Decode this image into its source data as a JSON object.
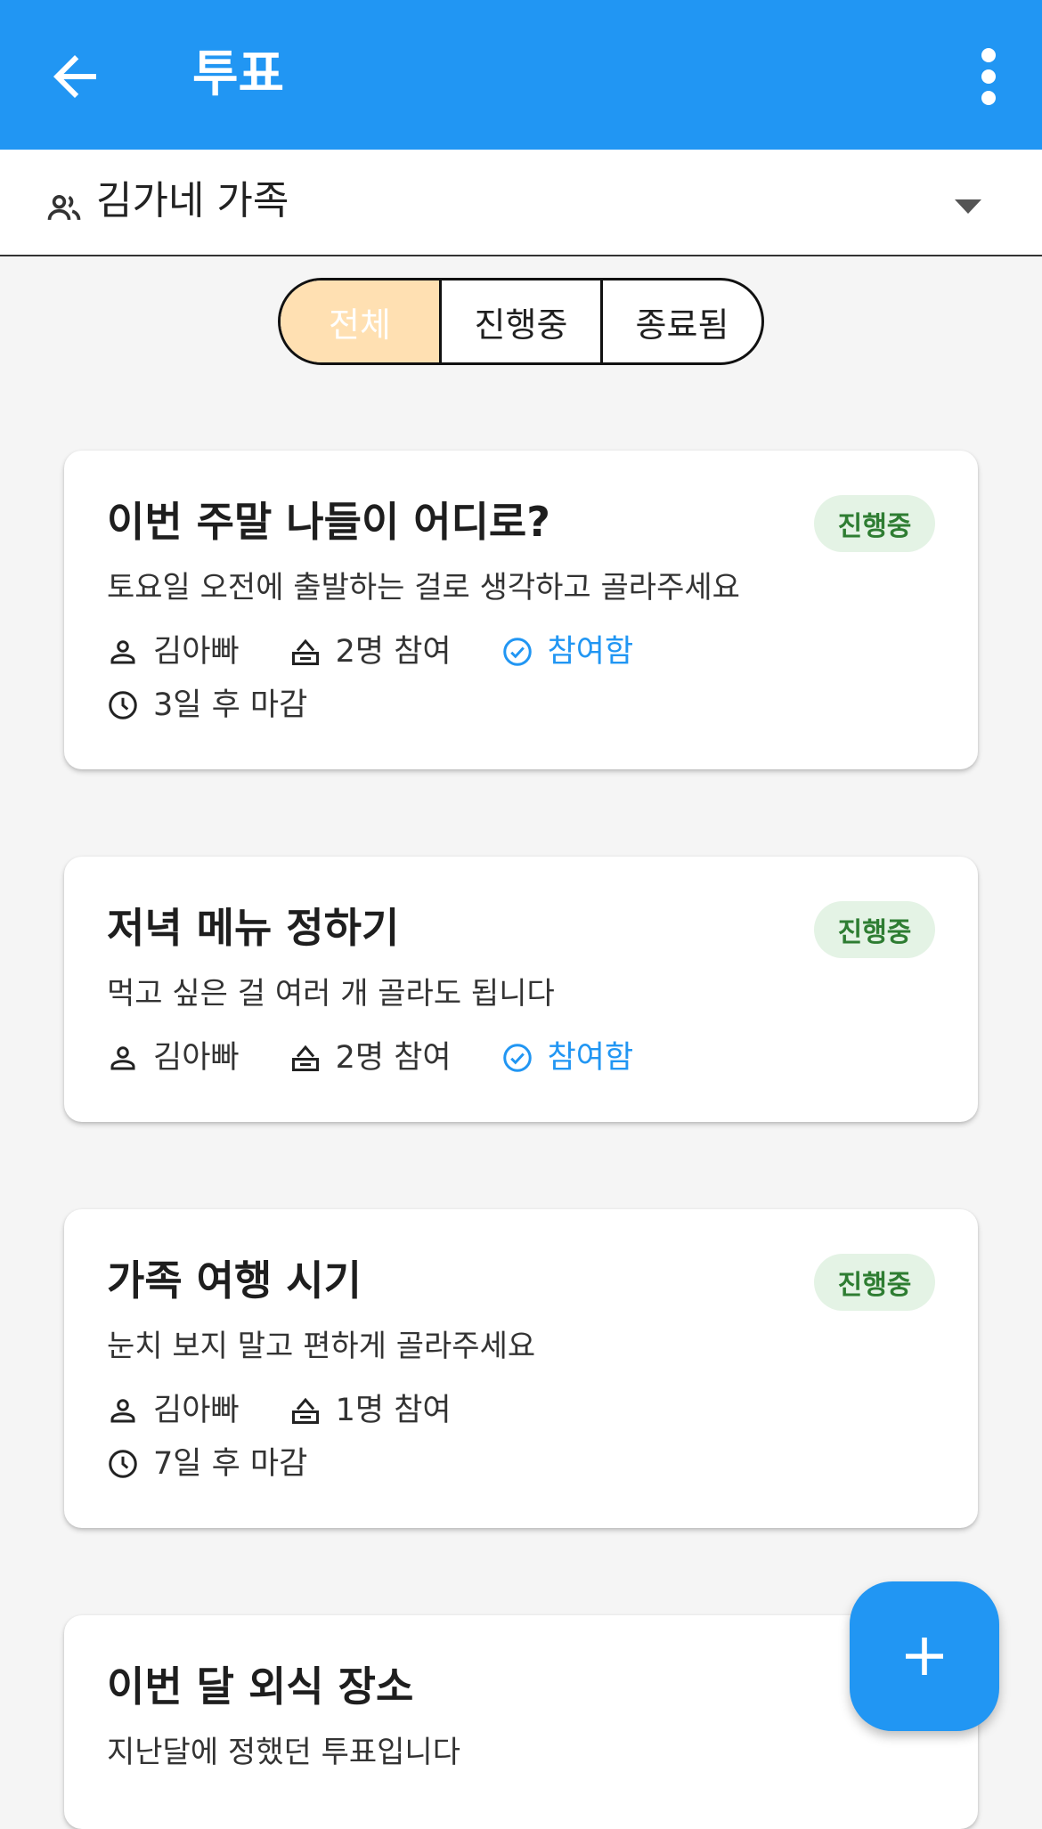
{
  "appbar": {
    "title": "투표",
    "back_icon": "arrow-back-icon",
    "more_icon": "more-vert-icon"
  },
  "group": {
    "name": "김가네 가족",
    "icon": "group-icon",
    "dropdown_icon": "caret-down-icon"
  },
  "filter": {
    "tabs": [
      "전체",
      "진행중",
      "종료됨"
    ],
    "selected": "전체"
  },
  "polls": [
    {
      "title": "이번 주말 나들이 어디로?",
      "status": "진행중",
      "description": "토요일 오전에 출발하는 걸로 생각하고 골라주세요",
      "author": "김아빠",
      "participants": "2명 참여",
      "joined": "참여함",
      "deadline": "3일 후 마감"
    },
    {
      "title": "저녁 메뉴 정하기",
      "status": "진행중",
      "description": "먹고 싶은 걸 여러 개 골라도 됩니다",
      "author": "김아빠",
      "participants": "2명 참여",
      "joined": "참여함"
    },
    {
      "title": "가족 여행 시기",
      "status": "진행중",
      "description": "눈치 보지 말고 편하게 골라주세요",
      "author": "김아빠",
      "participants": "1명 참여",
      "deadline": "7일 후 마감"
    },
    {
      "title": "이번 달 외식 장소",
      "description": "지난달에 정했던 투표입니다"
    }
  ],
  "fab": {
    "icon": "add-icon"
  },
  "colors": {
    "primary": "#2196f3",
    "active_tab": "#ffe0b2",
    "status_bg": "#e4f3e5",
    "status_text": "#2e7d32"
  }
}
